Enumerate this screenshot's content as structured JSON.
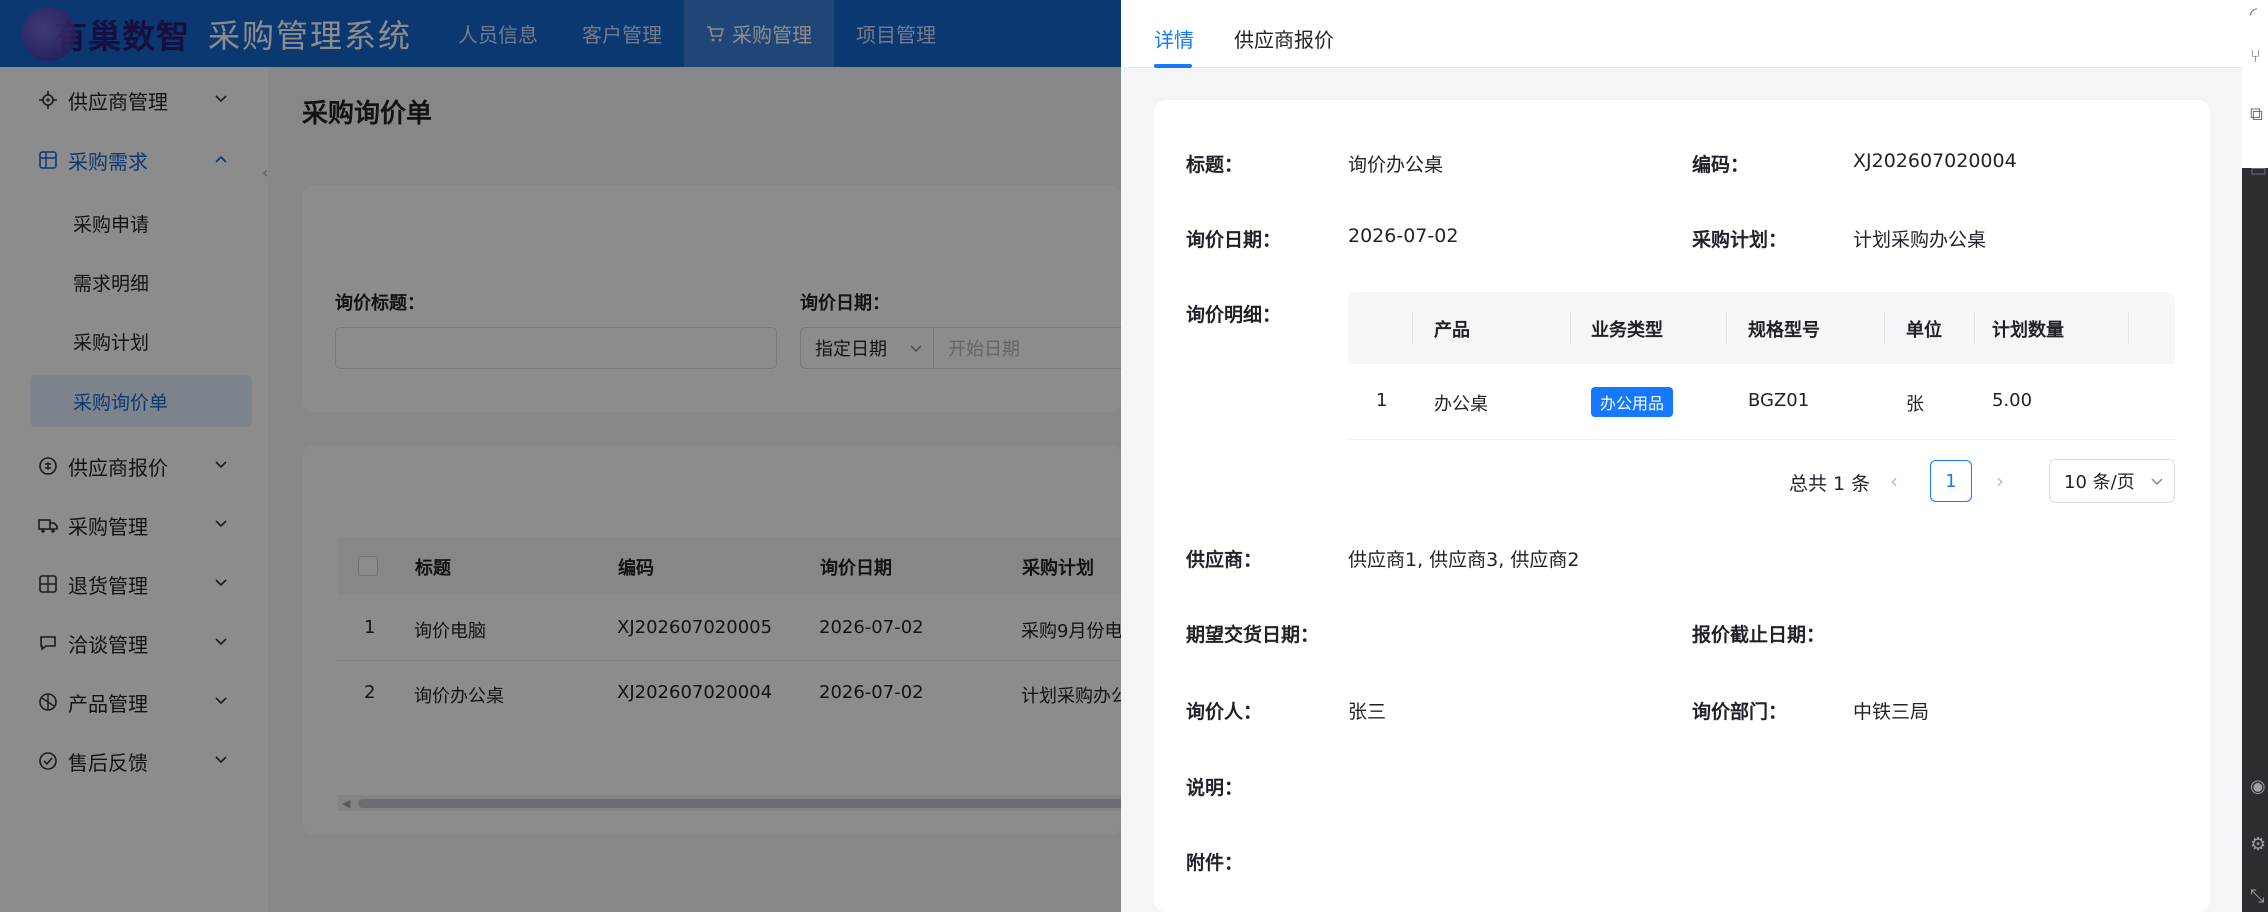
{
  "header": {
    "brand": "有巢数智",
    "app_title": "采购管理系统",
    "nav": [
      {
        "label": "人员信息",
        "active": false
      },
      {
        "label": "客户管理",
        "active": false
      },
      {
        "label": "采购管理",
        "active": true,
        "icon": "cart-icon"
      },
      {
        "label": "项目管理",
        "active": false
      }
    ]
  },
  "sidebar": {
    "items": [
      {
        "label": "供应商管理",
        "icon": "locate-icon",
        "open": false
      },
      {
        "label": "采购需求",
        "icon": "grid-icon",
        "open": true,
        "children": [
          "采购申请",
          "需求明细",
          "采购计划",
          "采购询价单"
        ],
        "active_child": "采购询价单"
      },
      {
        "label": "供应商报价",
        "icon": "quote-icon",
        "open": false
      },
      {
        "label": "采购管理",
        "icon": "truck-icon",
        "open": false
      },
      {
        "label": "退货管理",
        "icon": "return-icon",
        "open": false
      },
      {
        "label": "洽谈管理",
        "icon": "chat-icon",
        "open": false
      },
      {
        "label": "产品管理",
        "icon": "product-icon",
        "open": false
      },
      {
        "label": "售后反馈",
        "icon": "feedback-icon",
        "open": false
      }
    ]
  },
  "main": {
    "title": "采购询价单",
    "filters": {
      "title_label": "询价标题：",
      "date_label": "询价日期：",
      "date_type": "指定日期",
      "start_placeholder": "开始日期"
    },
    "table": {
      "headers": [
        "标题",
        "编码",
        "询价日期",
        "采购计划"
      ],
      "rows": [
        {
          "no": "1",
          "title": "询价电脑",
          "code": "XJ202607020005",
          "date": "2026-07-02",
          "plan": "采购9月份电"
        },
        {
          "no": "2",
          "title": "询价办公桌",
          "code": "XJ202607020004",
          "date": "2026-07-02",
          "plan": "计划采购办公"
        }
      ]
    }
  },
  "drawer": {
    "tabs": [
      "详情",
      "供应商报价"
    ],
    "active_tab": "详情",
    "fields": {
      "title_label": "标题：",
      "title_value": "询价办公桌",
      "code_label": "编码：",
      "code_value": "XJ202607020004",
      "date_label": "询价日期：",
      "date_value": "2026-07-02",
      "plan_label": "采购计划：",
      "plan_value": "计划采购办公桌",
      "detail_label": "询价明细：",
      "supplier_label": "供应商：",
      "supplier_value": "供应商1, 供应商3, 供应商2",
      "delivery_label": "期望交货日期：",
      "deadline_label": "报价截止日期：",
      "inquirer_label": "询价人：",
      "inquirer_value": "张三",
      "dept_label": "询价部门：",
      "dept_value": "中铁三局",
      "note_label": "说明：",
      "attach_label": "附件："
    },
    "detail_table": {
      "headers": [
        "产品",
        "业务类型",
        "规格型号",
        "单位",
        "计划数量"
      ],
      "rows": [
        {
          "no": "1",
          "product": "办公桌",
          "type": "办公用品",
          "spec": "BGZ01",
          "unit": "张",
          "qty": "5.00"
        }
      ]
    },
    "pagination": {
      "total": "总共 1 条",
      "current": "1",
      "page_size": "10 条/页"
    }
  },
  "colors": {
    "primary": "#1667ce",
    "accent": "#1677ff",
    "overlay": "rgba(0,0,0,0.45)"
  }
}
